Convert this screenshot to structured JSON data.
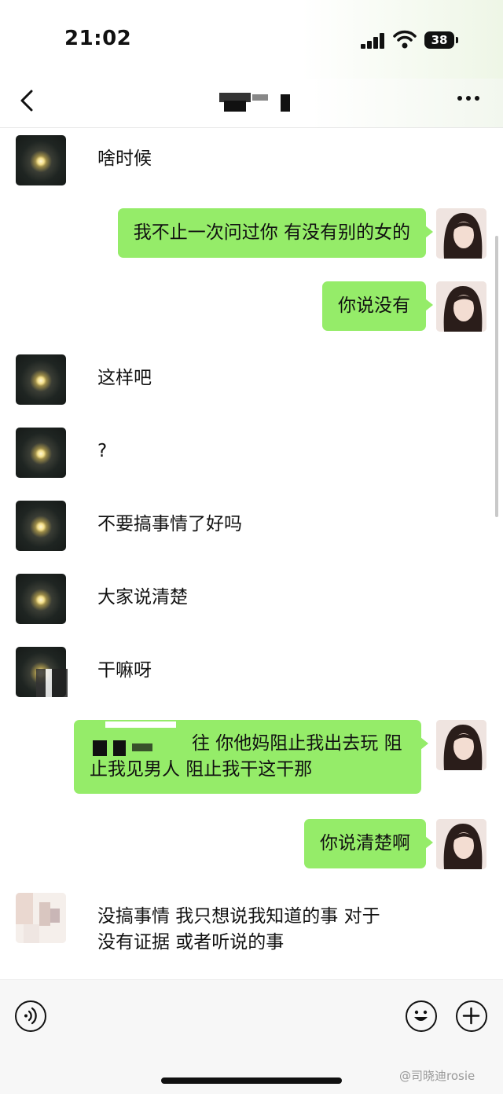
{
  "status_bar": {
    "time": "21:02",
    "battery": "38"
  },
  "nav": {
    "back_icon": "chevron-left-icon",
    "more_icon": "ellipsis-icon"
  },
  "messages": [
    {
      "side": "in",
      "avatar": "moon-avatar",
      "text": "啥时候"
    },
    {
      "side": "out",
      "avatar": "girl-avatar",
      "text": "我不止一次问过你 有没有别的女的"
    },
    {
      "side": "out",
      "avatar": "girl-avatar",
      "text": "你说没有"
    },
    {
      "side": "in",
      "avatar": "moon-avatar",
      "text": "这样吧"
    },
    {
      "side": "in",
      "avatar": "moon-avatar",
      "text": "?"
    },
    {
      "side": "in",
      "avatar": "moon-avatar",
      "text": "不要搞事情了好吗"
    },
    {
      "side": "in",
      "avatar": "moon-avatar",
      "text": "大家说清楚"
    },
    {
      "side": "in",
      "avatar": "moon-avatar",
      "text": "干嘛呀"
    },
    {
      "side": "out",
      "avatar": "girl-avatar",
      "text_line1": "往 你他妈阻止我出去玩 阻",
      "text_line2": "止我见男人 阻止我干这干那"
    },
    {
      "side": "out",
      "avatar": "girl-avatar",
      "text": "你说清楚啊"
    },
    {
      "side": "in",
      "avatar": "blurred-avatar",
      "text_line1": "没搞事情 我只想说我知道的事 对于",
      "text_line2": "没有证据 或者听说的事"
    }
  ],
  "input_bar": {
    "voice_icon": "voice-icon",
    "emoji_icon": "emoji-icon",
    "add_icon": "plus-icon"
  },
  "watermark": "@司晓迪rosie",
  "colors": {
    "outgoing_bubble": "#95ec69",
    "background": "#ffffff",
    "input_bar": "#f7f7f7"
  }
}
